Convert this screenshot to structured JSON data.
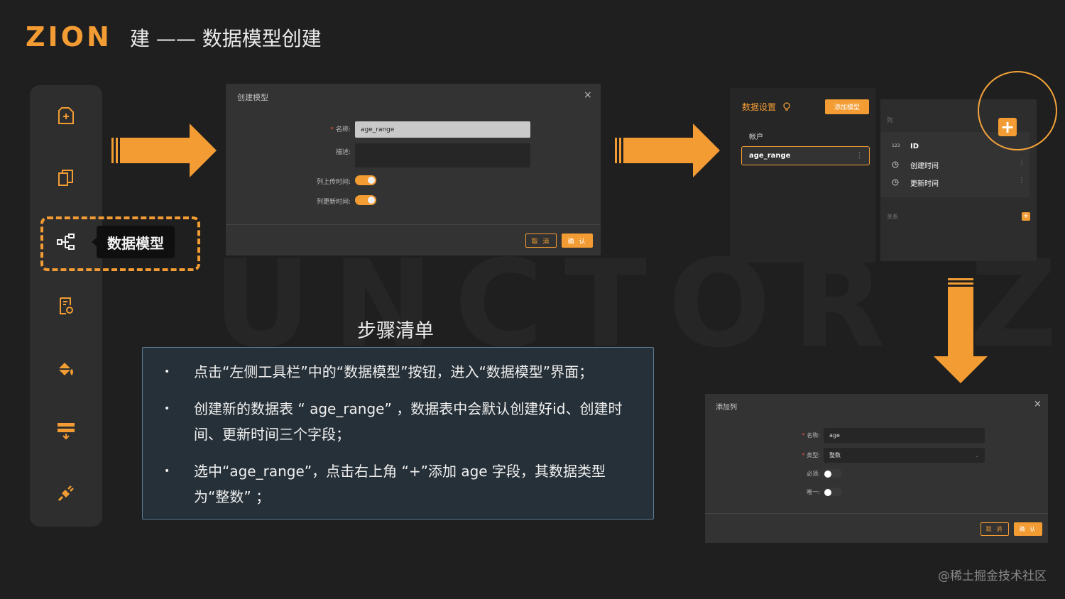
{
  "watermark": "UNCTOR Z",
  "header": {
    "logo": "ZION",
    "title": "建 —— 数据模型创建"
  },
  "toolbar": {
    "icons": [
      "page-add-icon",
      "pages-icon",
      "data-model-icon",
      "settings-file-icon",
      "paint-bucket-icon",
      "layout-icon",
      "plugin-icon"
    ],
    "tooltip": "数据模型"
  },
  "create_modal": {
    "title": "创建模型",
    "close": "×",
    "name_label": "名称:",
    "name_value": "age_range",
    "desc_label": "描述:",
    "upload_time_label": "列上传时间:",
    "update_time_label": "列更新时间:",
    "cancel": "取 消",
    "confirm": "确 认"
  },
  "data_settings": {
    "title": "数据设置",
    "add_model": "添加模型",
    "account": "帐户",
    "selected_model": "age_range"
  },
  "columns_panel": {
    "header": "列",
    "rows": [
      {
        "icon": "123",
        "label": "ID"
      },
      {
        "icon": "clock-icon",
        "label": "创建时间"
      },
      {
        "icon": "clock-icon",
        "label": "更新时间"
      }
    ],
    "relations": "关系",
    "plus": "+"
  },
  "steps": {
    "title": "步骤清单",
    "items": [
      "点击“左侧工具栏”中的“数据模型”按钮，进入“数据模型”界面；",
      "创建新的数据表 “ age_range” ，数据表中会默认创建好id、创建时间、更新时间三个字段；",
      "选中“age_range”，点击右上角 “+”添加 age 字段，其数据类型为“整数” ；"
    ],
    "bullet": "•"
  },
  "add_column_modal": {
    "title": "添加列",
    "close": "×",
    "name_label": "名称:",
    "name_value": "age",
    "type_label": "类型:",
    "type_value": "整数",
    "required_label": "必须:",
    "unique_label": "唯一:",
    "cancel": "取 消",
    "confirm": "确 认"
  },
  "footer": "@稀土掘金技术社区",
  "colors": {
    "accent": "#f39c33",
    "bg": "#1f1f1f"
  }
}
